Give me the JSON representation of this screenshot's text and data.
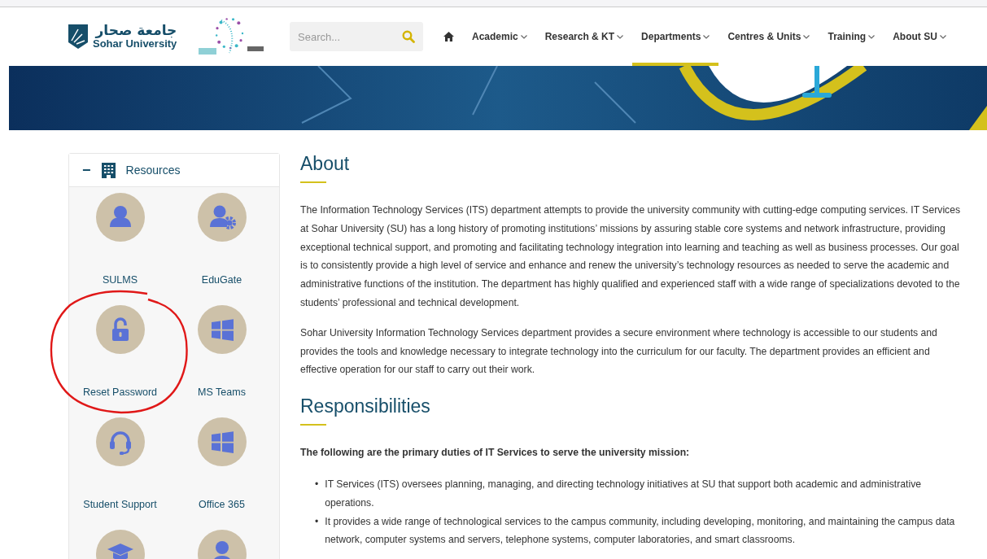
{
  "header": {
    "logo": {
      "arabic": "جامعة صحار",
      "english": "Sohar University"
    },
    "search": {
      "placeholder": "Search..."
    },
    "nav": [
      {
        "kind": "home",
        "selected": false
      },
      {
        "kind": "menu",
        "label": "Academic",
        "selected": false
      },
      {
        "kind": "menu",
        "label": "Research & KT",
        "selected": false
      },
      {
        "kind": "menu",
        "label": "Departments",
        "selected": true
      },
      {
        "kind": "menu",
        "label": "Centres & Units",
        "selected": false
      },
      {
        "kind": "menu",
        "label": "Training",
        "selected": false
      },
      {
        "kind": "menu",
        "label": "About SU",
        "selected": false
      }
    ]
  },
  "sidebar": {
    "title": "Resources",
    "toggle": "−",
    "expanded": true,
    "items": [
      {
        "label": "SULMS",
        "annotated": false
      },
      {
        "label": "EduGate",
        "annotated": false
      },
      {
        "label": "Reset Password",
        "annotated": true
      },
      {
        "label": "MS Teams",
        "annotated": false
      },
      {
        "label": "Student Support",
        "annotated": false
      },
      {
        "label": "Office 365",
        "annotated": false
      },
      {
        "annotated": false
      },
      {
        "annotated": false
      }
    ]
  },
  "content": {
    "sections": [
      {
        "heading": "About",
        "paragraphs": [
          "The Information Technology Services (ITS) department attempts to provide the university community with cutting-edge computing services. IT Services at Sohar University (SU) has a long history of promoting institutions’ missions by assuring stable core systems and network infrastructure, providing exceptional technical support, and promoting and facilitating technology integration into learning and teaching as well as business processes. Our goal is to consistently provide a high level of service and enhance and renew the university’s technology resources as needed to serve the academic and administrative functions of the institution. The department has highly qualified and experienced staff with a wide range of specializations devoted to the students’ professional and technical development.",
          "Sohar University Information Technology Services department provides a secure environment where technology is accessible to our students and provides the tools and knowledge necessary to integrate technology into the curriculum for our faculty. The department provides an efficient and effective operation for our staff to carry out their work."
        ]
      },
      {
        "heading": "Responsibilities",
        "intro": "The following are the primary duties of IT Services to serve the university mission:",
        "bullets": [
          {
            "marker": "•",
            "text": "IT Services (ITS) oversees planning, managing, and directing technology initiatives at SU that support both academic and administrative operations."
          },
          {
            "marker": "•",
            "text": "It provides a wide range of technological services to the campus community, including developing, monitoring, and maintaining the campus data network, computer systems and servers, telephone systems, computer laboratories, and smart classrooms."
          }
        ]
      }
    ]
  }
}
